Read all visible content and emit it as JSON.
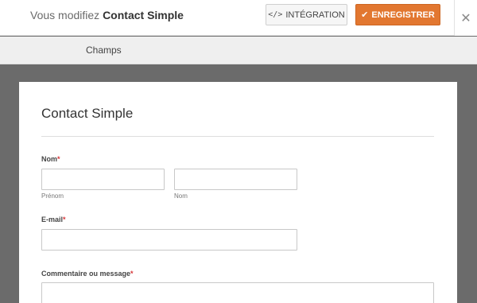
{
  "header": {
    "editing_prefix": "Vous modifiez",
    "form_name": "Contact Simple",
    "embed_icon": "code-icon",
    "embed_label": "INTÉGRATION",
    "save_icon": "check-icon",
    "save_label": "ENREGISTRER",
    "close_icon": "close-icon"
  },
  "tabs": [
    {
      "label": "Champs"
    }
  ],
  "form": {
    "title": "Contact Simple",
    "fields": {
      "name": {
        "label": "Nom",
        "required_mark": "*",
        "first_sublabel": "Prénom",
        "last_sublabel": "Nom",
        "first_value": "",
        "last_value": ""
      },
      "email": {
        "label": "E-mail",
        "required_mark": "*",
        "value": ""
      },
      "message": {
        "label": "Commentaire ou message",
        "required_mark": "*",
        "value": ""
      }
    }
  },
  "colors": {
    "accent": "#e27730",
    "required": "#d63638",
    "backdrop": "#6b6b6b"
  }
}
